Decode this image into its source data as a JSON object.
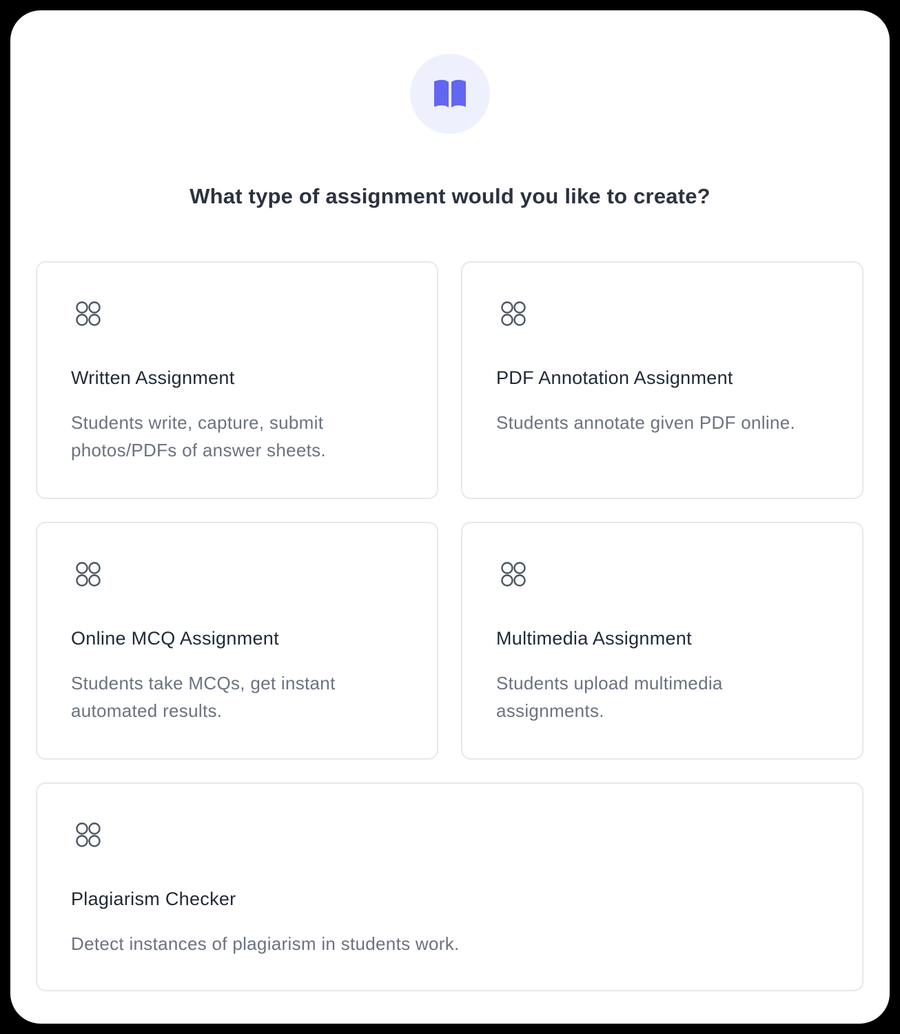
{
  "header": {
    "icon": "open-book-icon",
    "accent_color": "#6366f1",
    "icon_background": "#eef1fd",
    "title": "What type of assignment would you like to create?"
  },
  "cards": [
    {
      "icon": "grid-circles-icon",
      "title": "Written Assignment",
      "description": "Students write, capture, submit photos/PDFs of answer sheets."
    },
    {
      "icon": "grid-circles-icon",
      "title": "PDF Annotation Assignment",
      "description": "Students annotate given PDF online."
    },
    {
      "icon": "grid-circles-icon",
      "title": "Online MCQ Assignment",
      "description": "Students take MCQs, get instant automated results."
    },
    {
      "icon": "grid-circles-icon",
      "title": "Multimedia Assignment",
      "description": "Students upload multimedia assignments."
    },
    {
      "icon": "grid-circles-icon",
      "title": "Plagiarism Checker",
      "description": "Detect instances of plagiarism in students work."
    }
  ]
}
